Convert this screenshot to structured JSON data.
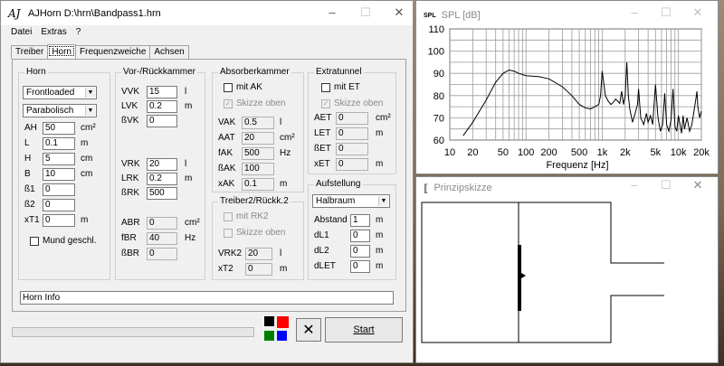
{
  "main_window": {
    "title": "AJHorn  D:\\hrn\\Bandpass1.hrn",
    "menu": [
      "Datei",
      "Extras",
      "?"
    ],
    "tabs": [
      "Treiber",
      "Horn",
      "Frequenzweiche",
      "Achsen"
    ],
    "horn": {
      "group_title": "Horn",
      "type_combo": "Frontloaded",
      "profile_combo": "Parabolisch",
      "rows": [
        {
          "label": "AH",
          "value": "50",
          "unit": "cm²"
        },
        {
          "label": "L",
          "value": "0.1",
          "unit": "m"
        },
        {
          "label": "H",
          "value": "5",
          "unit": "cm"
        },
        {
          "label": "B",
          "value": "10",
          "unit": "cm"
        },
        {
          "label": "ß1",
          "value": "0",
          "unit": ""
        },
        {
          "label": "ß2",
          "value": "0",
          "unit": ""
        },
        {
          "label": "xT1",
          "value": "0",
          "unit": "m"
        }
      ],
      "mund_label": "Mund geschl."
    },
    "vor": {
      "group_title": "Vor-/Rückkammer",
      "rows1": [
        {
          "label": "VVK",
          "value": "15",
          "unit": "l"
        },
        {
          "label": "LVK",
          "value": "0.2",
          "unit": "m"
        },
        {
          "label": "ßVK",
          "value": "0",
          "unit": ""
        }
      ],
      "rows2": [
        {
          "label": "VRK",
          "value": "20",
          "unit": "l"
        },
        {
          "label": "LRK",
          "value": "0.2",
          "unit": "m"
        },
        {
          "label": "ßRK",
          "value": "500",
          "unit": ""
        }
      ],
      "rows3": [
        {
          "label": "ABR",
          "value": "0",
          "unit": "cm²"
        },
        {
          "label": "fBR",
          "value": "40",
          "unit": "Hz"
        },
        {
          "label": "ßBR",
          "value": "0",
          "unit": ""
        }
      ]
    },
    "absorber": {
      "group_title": "Absorberkammer",
      "chk1": "mit AK",
      "chk2": "Skizze oben",
      "rows": [
        {
          "label": "VAK",
          "value": "0.5",
          "unit": "l"
        },
        {
          "label": "AAT",
          "value": "20",
          "unit": "cm²"
        },
        {
          "label": "fAK",
          "value": "500",
          "unit": "Hz"
        },
        {
          "label": "ßAK",
          "value": "100",
          "unit": ""
        },
        {
          "label": "xAK",
          "value": "0.1",
          "unit": "m"
        }
      ]
    },
    "treiber2": {
      "group_title": "Treiber2/Rückk.2",
      "chk1": "mit RK2",
      "chk2": "Skizze oben",
      "rows": [
        {
          "label": "VRK2",
          "value": "20",
          "unit": "l"
        },
        {
          "label": "xT2",
          "value": "0",
          "unit": "m"
        }
      ]
    },
    "extratunnel": {
      "group_title": "Extratunnel",
      "chk1": "mit ET",
      "chk2": "Skizze oben",
      "rows": [
        {
          "label": "AET",
          "value": "0",
          "unit": "cm²"
        },
        {
          "label": "LET",
          "value": "0",
          "unit": "m"
        },
        {
          "label": "ßET",
          "value": "0",
          "unit": ""
        },
        {
          "label": "xET",
          "value": "0",
          "unit": "m"
        }
      ]
    },
    "aufstellung": {
      "group_title": "Aufstellung",
      "combo": "Halbraum",
      "rows": [
        {
          "label": "Abstand",
          "value": "1",
          "unit": "m"
        },
        {
          "label": "dL1",
          "value": "0",
          "unit": "m"
        },
        {
          "label": "dL2",
          "value": "0",
          "unit": "m"
        },
        {
          "label": "dLET",
          "value": "0",
          "unit": "m"
        }
      ]
    },
    "info_text": "Horn Info",
    "start_label": "Start",
    "swatch_colors": [
      "#000000",
      "#ff0000",
      "#008000",
      "#0000ff"
    ]
  },
  "spl_window": {
    "title_icon": "SPL",
    "title": "SPL [dB]"
  },
  "skizze_window": {
    "title": "Prinzipskizze"
  },
  "chart_data": {
    "type": "line",
    "title": "",
    "xlabel": "Frequenz [Hz]",
    "ylabel": "",
    "x_scale": "log",
    "xlim": [
      10,
      20000
    ],
    "ylim": [
      60,
      110
    ],
    "grid": true,
    "x_ticks": [
      10,
      20,
      50,
      100,
      200,
      500,
      1000,
      2000,
      5000,
      10000,
      20000
    ],
    "x_tick_labels": [
      "10",
      "20",
      "50",
      "100",
      "200",
      "500",
      "1k",
      "2k",
      "5k",
      "10k",
      "20k"
    ],
    "y_ticks": [
      60,
      70,
      80,
      90,
      100,
      110
    ],
    "y_tick_labels": [
      "60",
      "70",
      "80",
      "90",
      "100",
      "110"
    ],
    "series": [
      {
        "color": "#000000",
        "x": [
          15,
          20,
          30,
          40,
          50,
          60,
          70,
          80,
          100,
          150,
          200,
          300,
          400,
          500,
          600,
          700,
          800,
          900,
          950,
          1000,
          1100,
          1200,
          1300,
          1400,
          1500,
          1600,
          1700,
          1800,
          1900,
          2000,
          2100,
          2200,
          2300,
          2500,
          2700,
          2900,
          3000,
          3200,
          3500,
          3800,
          4000,
          4300,
          4600,
          5000,
          5400,
          5800,
          6200,
          6600,
          7000,
          7500,
          8000,
          8500,
          9000,
          9500,
          10000,
          10500,
          11000,
          11500,
          12000,
          13000,
          14000,
          15000,
          16000,
          17000,
          17500,
          18000,
          19000,
          20000
        ],
        "y": [
          62,
          68,
          78,
          86,
          90,
          91.5,
          91,
          90,
          89,
          88.5,
          87.5,
          84,
          80,
          76,
          74.5,
          74,
          75,
          76,
          80,
          91,
          80,
          77.5,
          76,
          77,
          78.5,
          77.5,
          76.5,
          82,
          76,
          80,
          95,
          80,
          74,
          68,
          72,
          76,
          83,
          70,
          67,
          72,
          68,
          71,
          67,
          85,
          70,
          64,
          67,
          81,
          67,
          64,
          69,
          83,
          66,
          64,
          71,
          67,
          63,
          71,
          65,
          70,
          64,
          67,
          73,
          79,
          82,
          75,
          70,
          73
        ]
      }
    ]
  }
}
